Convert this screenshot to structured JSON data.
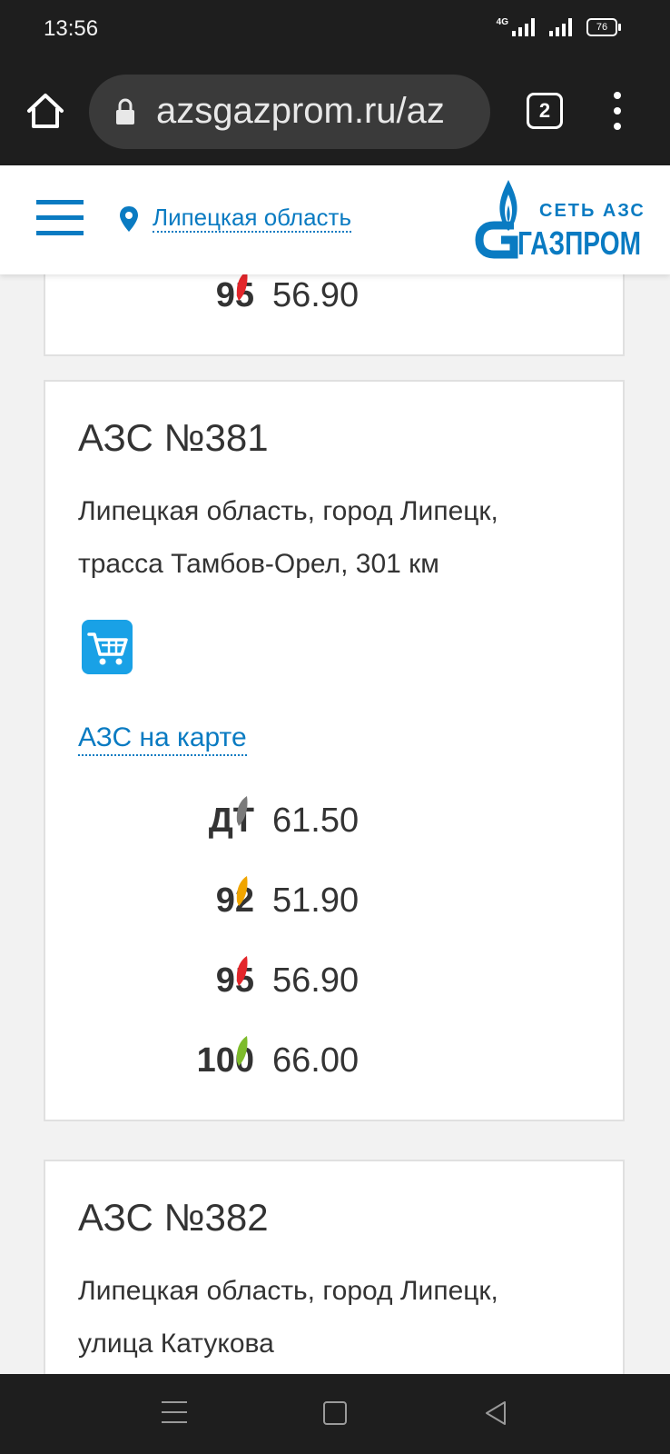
{
  "status_bar": {
    "time": "13:56",
    "network": "4G",
    "battery": "76"
  },
  "browser": {
    "url": "azsgazprom.ru/az",
    "tab_count": "2"
  },
  "header": {
    "region": "Липецкая область",
    "logo_text_top": "СЕТЬ АЗС",
    "logo_text_main": "ГАЗПРОМ",
    "brand_color": "#0a7bc2"
  },
  "partial_card": {
    "fuels": [
      {
        "name": "95",
        "price": "56.90",
        "color": "#e3262b"
      }
    ]
  },
  "stations": [
    {
      "title": "АЗС №381",
      "address": "Липецкая область, город Липецк, трасса Тамбов-Орел, 301 км",
      "service_icon": "shopping-cart-icon",
      "map_link": "АЗС на карте",
      "fuels": [
        {
          "name": "ДТ",
          "price": "61.50",
          "color": "#7a7a7a"
        },
        {
          "name": "92",
          "price": "51.90",
          "color": "#f0a500"
        },
        {
          "name": "95",
          "price": "56.90",
          "color": "#e3262b"
        },
        {
          "name": "100",
          "price": "66.00",
          "color": "#7dbb2b"
        }
      ]
    },
    {
      "title": "АЗС №382",
      "address": "Липецкая область, город Липецк, улица Катукова"
    }
  ]
}
